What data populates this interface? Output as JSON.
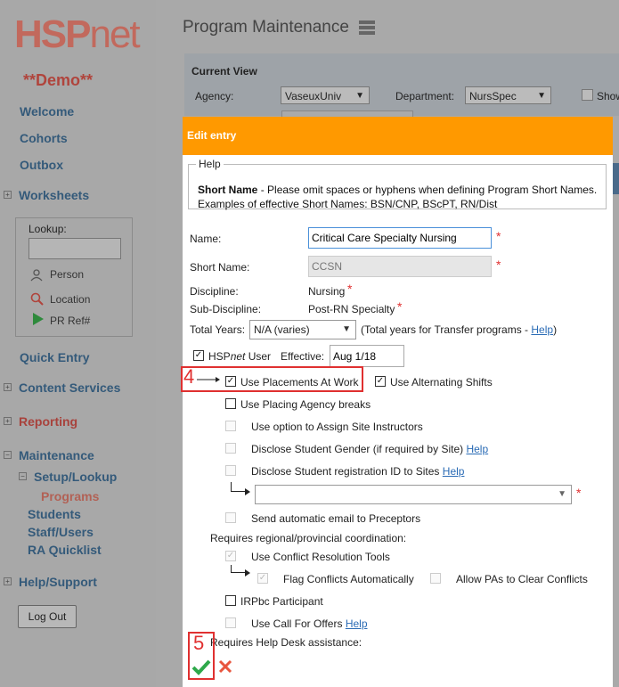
{
  "sidebar": {
    "logo_hsp": "HSP",
    "logo_net": "net",
    "demo": "**Demo**",
    "items": {
      "welcome": "Welcome",
      "cohorts": "Cohorts",
      "outbox": "Outbox",
      "worksheets": "Worksheets",
      "quick_entry": "Quick Entry",
      "content_services": "Content Services",
      "reporting": "Reporting",
      "maintenance": "Maintenance",
      "setup_lookup": "Setup/Lookup",
      "programs": "Programs",
      "students": "Students",
      "staff_users": "Staff/Users",
      "ra_quicklist": "RA Quicklist",
      "help_support": "Help/Support"
    },
    "lookup": {
      "label": "Lookup:",
      "person": "Person",
      "location": "Location",
      "pr_ref": "PR Ref#"
    },
    "logout": "Log Out"
  },
  "header": {
    "title": "Program Maintenance",
    "current_view": "Current View",
    "agency_label": "Agency:",
    "agency_value": "VaseuxUniv",
    "department_label": "Department:",
    "department_value": "NursSpec",
    "show_label": "Show"
  },
  "dialog": {
    "title": "Edit entry",
    "help_legend": "Help",
    "help_bold": "Short Name",
    "help_text": " - Please omit spaces or hyphens when defining Program Short Names. Examples of effective Short Names: BSN/CNP, BScPT, RN/Dist",
    "name_label": "Name:",
    "name_value": "Critical Care Specialty Nursing",
    "short_name_label": "Short Name:",
    "short_name_value": "CCSN",
    "discipline_label": "Discipline:",
    "discipline_value": "Nursing",
    "sub_discipline_label": "Sub-Discipline:",
    "sub_discipline_value": "Post-RN Specialty",
    "total_years_label": "Total Years:",
    "total_years_value": "N/A (varies)",
    "total_years_note": "(Total years for Transfer programs - ",
    "total_years_note_end": ")",
    "help_link": "Help",
    "hspnet_user_a": "HSP",
    "hspnet_user_b": "net",
    "hspnet_user_c": " User",
    "effective_label": "Effective:",
    "effective_value": "Aug 1/18",
    "use_placements": "Use Placements At Work",
    "use_alternating": "Use Alternating Shifts",
    "use_placing_agency": "Use Placing Agency breaks",
    "assign_site_instructors": "Use option to Assign Site Instructors",
    "disclose_gender": "Disclose Student Gender (if required by Site)",
    "disclose_registration": "Disclose Student registration ID to Sites",
    "send_email": "Send automatic email to Preceptors",
    "requires_regional": "Requires regional/provincial coordination:",
    "use_conflict": "Use Conflict Resolution Tools",
    "flag_conflicts": "Flag Conflicts Automatically",
    "allow_pas": "Allow PAs to Clear Conflicts",
    "irpbc": "IRPbc Participant",
    "use_call": "Use Call For Offers",
    "requires_helpdesk": "Requires Help Desk assistance:",
    "step4": "4",
    "step5": "5",
    "save_icon": "check-icon",
    "cancel_icon": "close-icon"
  },
  "colors": {
    "header_orange": "#ff9900",
    "annotation_red": "#e03030",
    "link_blue": "#2a6bb5",
    "save_green": "#2ea84a"
  }
}
